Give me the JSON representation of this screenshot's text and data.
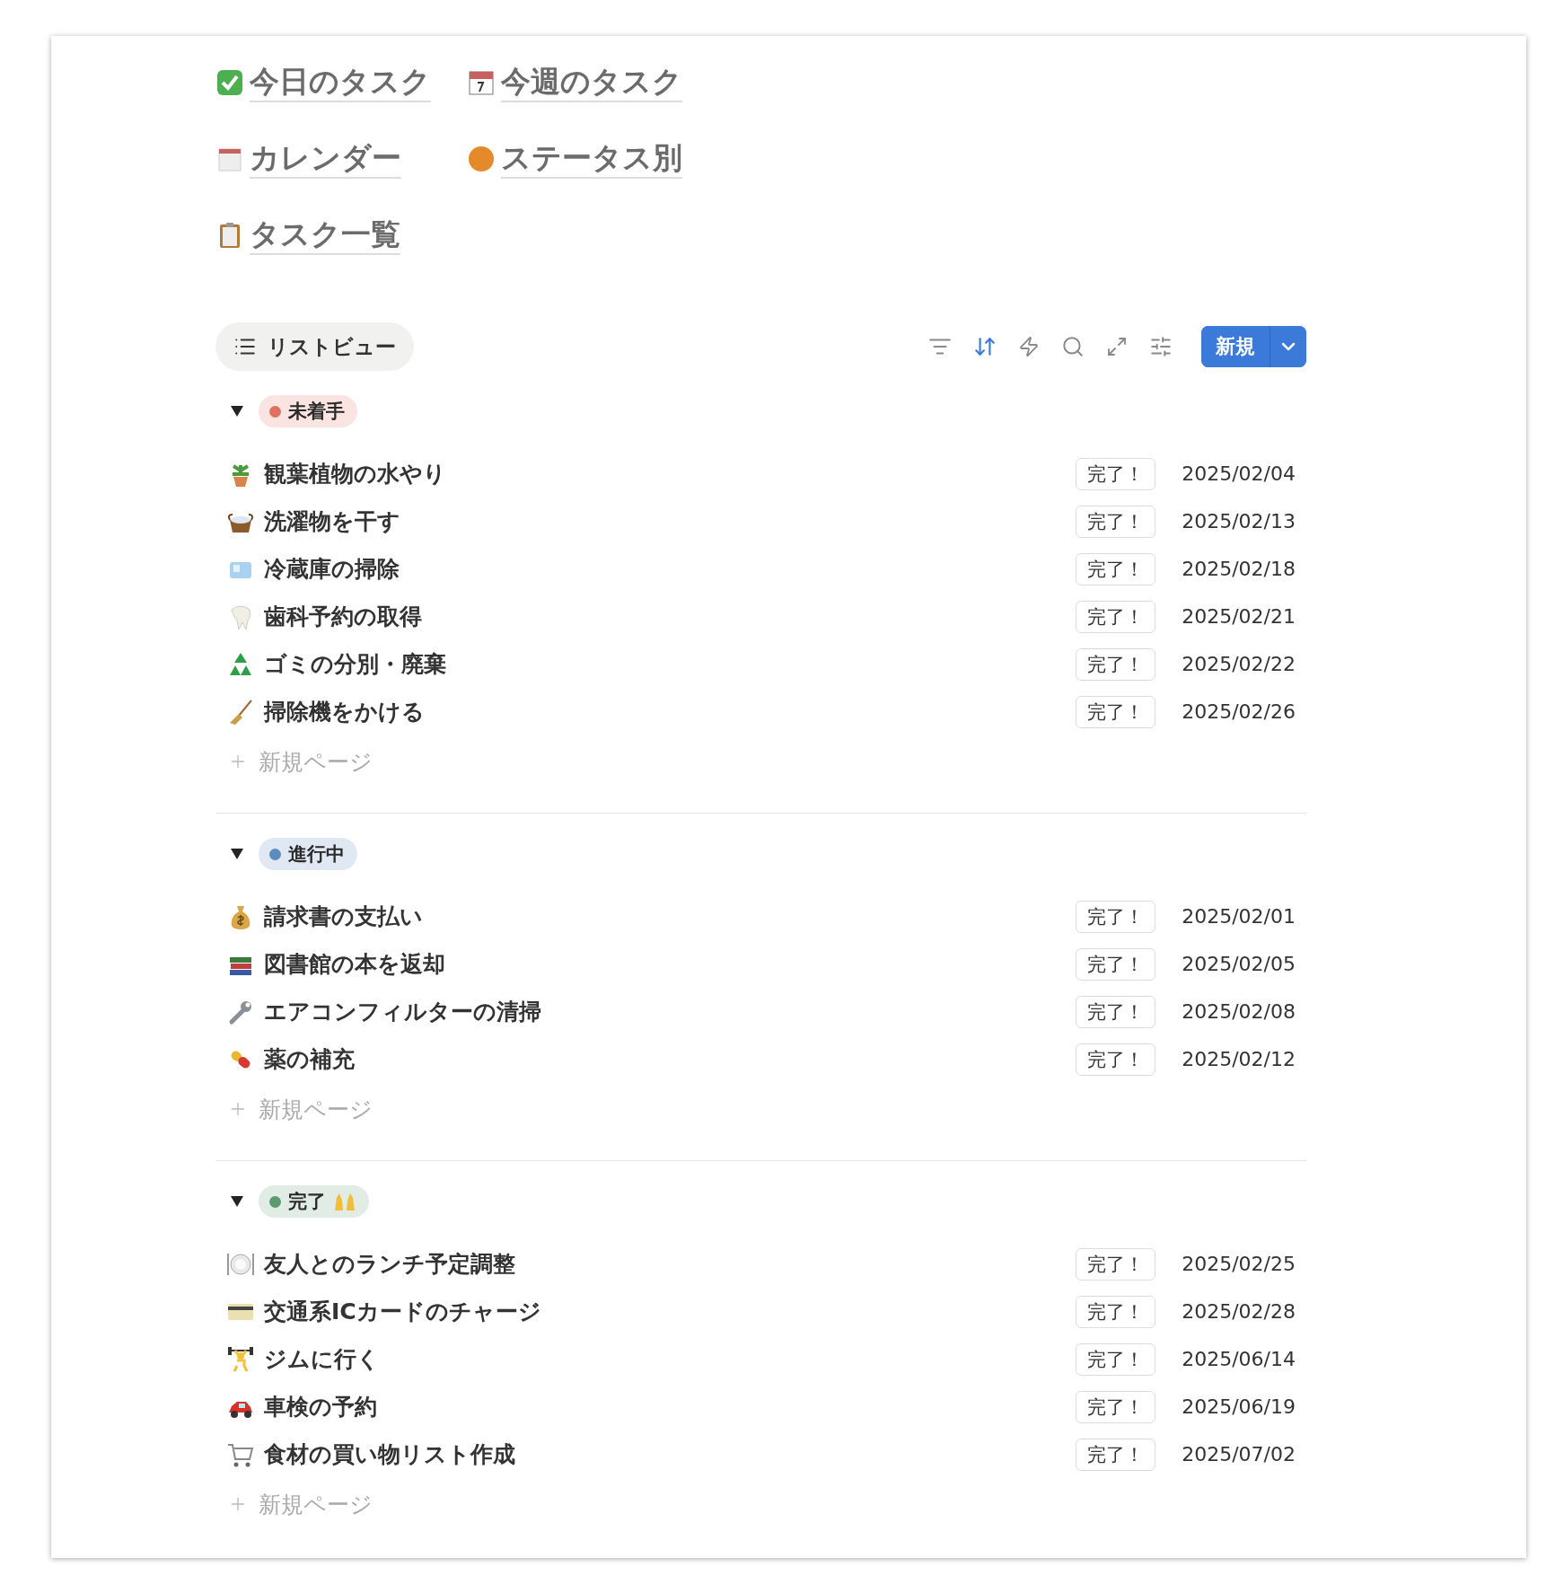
{
  "links": [
    {
      "label": "今日のタスク"
    },
    {
      "label": "今週のタスク"
    },
    {
      "label": "カレンダー"
    },
    {
      "label": "ステータス別"
    },
    {
      "label": "タスク一覧"
    }
  ],
  "toolbar": {
    "view_tab": {
      "label": "リストビュー",
      "selected": true
    },
    "sort_active": true,
    "new_button": "新規"
  },
  "groups": [
    {
      "label": "未着手",
      "color": "#e0705f",
      "expanded": true,
      "tasks": [
        {
          "title": "観葉植物の水やり",
          "action": "完了！",
          "date": "2025/02/04"
        },
        {
          "title": "洗濯物を干す",
          "action": "完了！",
          "date": "2025/02/13"
        },
        {
          "title": "冷蔵庫の掃除",
          "action": "完了！",
          "date": "2025/02/18"
        },
        {
          "title": "歯科予約の取得",
          "action": "完了！",
          "date": "2025/02/21"
        },
        {
          "title": "ゴミの分別・廃棄",
          "action": "完了！",
          "date": "2025/02/22"
        },
        {
          "title": "掃除機をかける",
          "action": "完了！",
          "date": "2025/02/26"
        }
      ],
      "new_page": "新規ページ"
    },
    {
      "label": "進行中",
      "color": "#5b8cc0",
      "expanded": true,
      "tasks": [
        {
          "title": "請求書の支払い",
          "action": "完了！",
          "date": "2025/02/01"
        },
        {
          "title": "図書館の本を返却",
          "action": "完了！",
          "date": "2025/02/05"
        },
        {
          "title": "エアコンフィルターの清掃",
          "action": "完了！",
          "date": "2025/02/08"
        },
        {
          "title": "薬の補充",
          "action": "完了！",
          "date": "2025/02/12"
        }
      ],
      "new_page": "新規ページ"
    },
    {
      "label": "完了",
      "color": "#5c9a70",
      "expanded": true,
      "tasks": [
        {
          "title": "友人とのランチ予定調整",
          "action": "完了！",
          "date": "2025/02/25"
        },
        {
          "title": "交通系ICカードのチャージ",
          "action": "完了！",
          "date": "2025/02/28"
        },
        {
          "title": "ジムに行く",
          "action": "完了！",
          "date": "2025/06/14"
        },
        {
          "title": "車検の予約",
          "action": "完了！",
          "date": "2025/06/19"
        },
        {
          "title": "食材の買い物リスト作成",
          "action": "完了！",
          "date": "2025/07/02"
        }
      ],
      "new_page": "新規ページ"
    }
  ]
}
